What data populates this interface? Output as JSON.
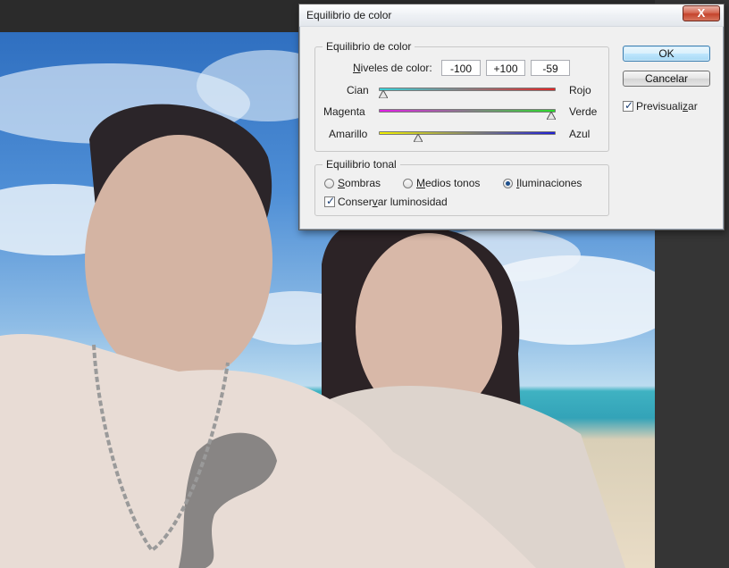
{
  "dialog": {
    "title": "Equilibrio de color",
    "close_label": "X"
  },
  "color_balance": {
    "legend": "Equilibrio de color",
    "levels_label": "Niveles de color:",
    "levels_mnemonic": "N",
    "levels_rest": "iveles de color:",
    "levels": [
      "-100",
      "+100",
      "-59"
    ],
    "sliders": [
      {
        "left": "Cian",
        "right": "Rojo",
        "value": -100,
        "colors": [
          "#38d2d9",
          "#e02626"
        ]
      },
      {
        "left": "Magenta",
        "right": "Verde",
        "value": 100,
        "colors": [
          "#e21ee6",
          "#2bdc2b"
        ]
      },
      {
        "left": "Amarillo",
        "right": "Azul",
        "value": -59,
        "colors": [
          "#f2f200",
          "#1f1fd6"
        ]
      }
    ]
  },
  "tonal_balance": {
    "legend": "Equilibrio tonal",
    "options": [
      {
        "pre": "",
        "mn": "S",
        "post": "ombras",
        "selected": false
      },
      {
        "pre": "",
        "mn": "M",
        "post": "edios tonos",
        "selected": false
      },
      {
        "pre": "",
        "mn": "I",
        "post": "luminaciones",
        "selected": true
      }
    ],
    "preserve": {
      "pre": "Conser",
      "mn": "v",
      "post": "ar luminosidad",
      "checked": true
    }
  },
  "buttons": {
    "ok": "OK",
    "cancel": "Cancelar"
  },
  "preview": {
    "pre": "Previsuali",
    "mn": "z",
    "post": "ar",
    "checked": true
  }
}
